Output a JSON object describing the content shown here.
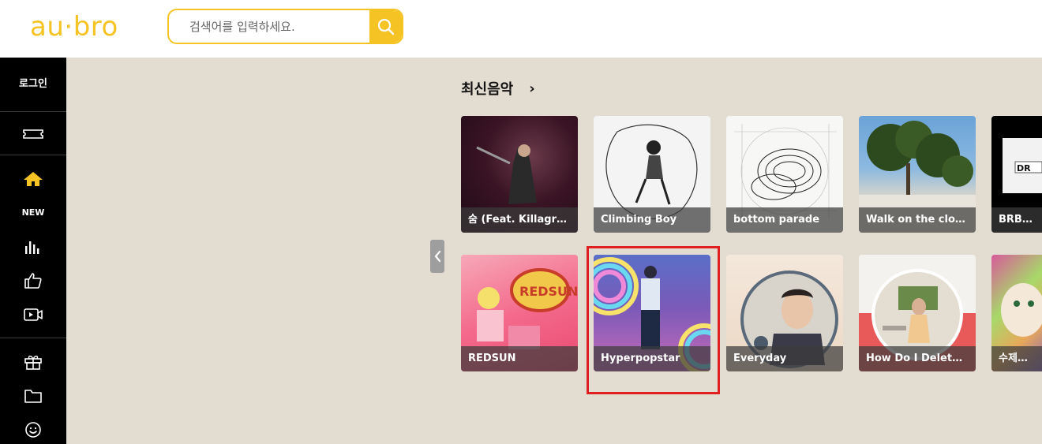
{
  "header": {
    "logo": "au·bro",
    "search_placeholder": "검색어를 입력하세요."
  },
  "sidebar": {
    "login": "로그인",
    "new_label": "NEW",
    "icons": [
      "ticket-icon",
      "home-icon",
      "chart-icon",
      "thumbs-up-icon",
      "video-icon",
      "gift-icon",
      "folder-icon",
      "smile-icon"
    ]
  },
  "main": {
    "section_title": "최신음악",
    "section_arrow": "›",
    "albums_row1": [
      {
        "title": "숨 (Feat. Killagra..."
      },
      {
        "title": "Climbing Boy"
      },
      {
        "title": "bottom parade"
      },
      {
        "title": "Walk on the clou..."
      },
      {
        "title": "BRB (Fea"
      }
    ],
    "albums_row2": [
      {
        "title": "REDSUN"
      },
      {
        "title": "Hyperpopstar"
      },
      {
        "title": "Everyday"
      },
      {
        "title": "How Do I Delete..."
      },
      {
        "title": "수제버거"
      }
    ]
  },
  "colors": {
    "accent": "#f6c324",
    "sidebar_bg": "#000000",
    "main_bg": "#e3dcd1",
    "highlight": "#e02020"
  }
}
